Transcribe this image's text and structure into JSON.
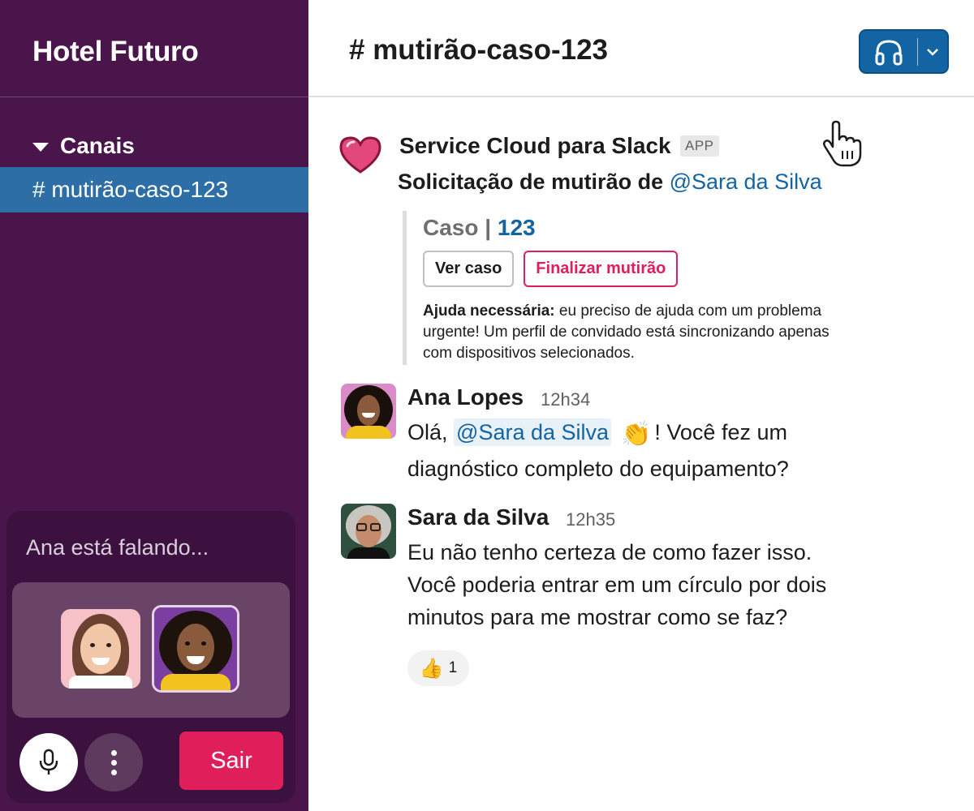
{
  "sidebar": {
    "workspace_name": "Hotel Futuro",
    "section_label": "Canais",
    "active_channel": "# mutirão-caso-123"
  },
  "huddle": {
    "status": "Ana está falando...",
    "leave_label": "Sair"
  },
  "header": {
    "channel_title": "# mutirão-caso-123"
  },
  "app_message": {
    "app_name": "Service Cloud para Slack",
    "badge": "APP",
    "line_prefix": "Solicitação de mutirão de ",
    "line_mention": "@Sara da Silva",
    "case_label": "Caso | ",
    "case_number": "123",
    "view_case_label": "Ver caso",
    "finish_label": "Finalizar mutirão",
    "help_label": "Ajuda necessária:",
    "help_text": " eu preciso de ajuda com um problema urgente! Um perfil de convidado está sincronizando apenas com dispositivos selecionados."
  },
  "messages": [
    {
      "author": "Ana Lopes",
      "time": "12h34",
      "prefix": "Olá, ",
      "mention": "@Sara da Silva",
      "emoji": "👏",
      "rest": "! Você fez um",
      "line2": "diagnóstico completo do equipamento?"
    },
    {
      "author": "Sara da Silva",
      "time": "12h35",
      "line1": "Eu não tenho certeza de como fazer isso.",
      "line2": "Você poderia entrar em um círculo por dois",
      "line3": "minutos para me mostrar como se faz?",
      "reaction_emoji": "👍",
      "reaction_count": "1"
    }
  ],
  "colors": {
    "sidebar_bg": "#4a154b",
    "active_channel_bg": "#2e6ea6",
    "accent_red": "#e01e5a",
    "link_blue": "#1264a3"
  },
  "icons": [
    "heart-icon",
    "headphones-icon",
    "chevron-down-icon",
    "hand-cursor-icon",
    "microphone-icon",
    "more-icon",
    "caret-down-icon"
  ]
}
